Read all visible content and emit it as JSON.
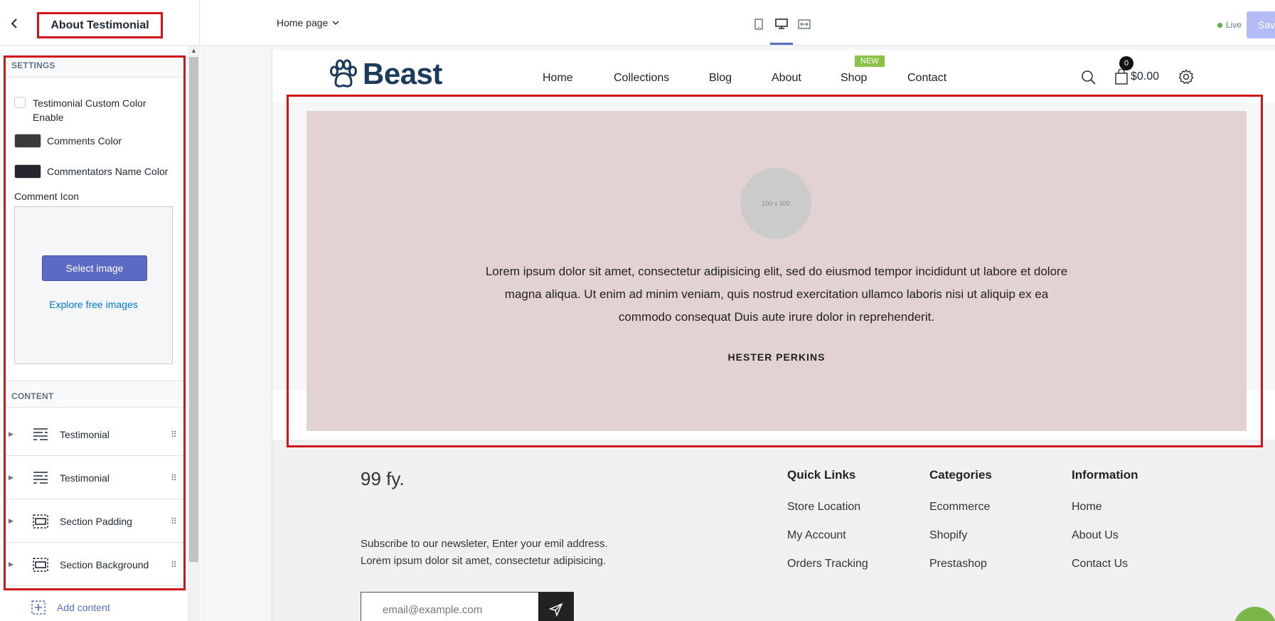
{
  "header": {
    "section_title": "About Testimonial",
    "page_selector": "Home page",
    "live_label": "Live",
    "save_label": "Save"
  },
  "sidebar": {
    "settings_heading": "SETTINGS",
    "custom_color_label": "Testimonial Custom Color Enable",
    "comments_color_label": "Comments Color",
    "comments_color": "#3a3a3a",
    "name_color_label": "Commentators Name Color",
    "name_color": "#25262b",
    "comment_icon_label": "Comment Icon",
    "select_image_label": "Select image",
    "explore_label": "Explore free images",
    "content_heading": "CONTENT",
    "blocks": [
      {
        "label": "Testimonial",
        "icon": "text-lines-icon"
      },
      {
        "label": "Testimonial",
        "icon": "text-lines-icon"
      },
      {
        "label": "Section Padding",
        "icon": "section-icon"
      },
      {
        "label": "Section Background",
        "icon": "section-icon"
      }
    ],
    "add_content_label": "Add content"
  },
  "store": {
    "logo_text": "Beast",
    "nav": [
      "Home",
      "Collections",
      "Blog",
      "About",
      "Shop",
      "Contact"
    ],
    "new_badge": "NEW",
    "cart_count": "0",
    "cart_total": "$0.00",
    "testimonial": {
      "avatar_placeholder": "100 x 100",
      "quote": "Lorem ipsum dolor sit amet, consectetur adipisicing elit, sed do eiusmod tempor incididunt ut labore et dolore magna aliqua. Ut enim ad minim veniam, quis nostrud exercitation ullamco laboris nisi ut aliquip ex ea commodo consequat Duis aute irure dolor in reprehenderit.",
      "author": "HESTER PERKINS"
    },
    "footer": {
      "brand": "99 fy.",
      "subscribe_line1": "Subscribe to our newsleter, Enter your emil address.",
      "subscribe_line2": "Lorem ipsum dolor sit amet, consectetur adipisicing.",
      "email_placeholder": "email@example.com",
      "columns": [
        {
          "heading": "Quick Links",
          "links": [
            "Store Location",
            "My Account",
            "Orders Tracking"
          ]
        },
        {
          "heading": "Categories",
          "links": [
            "Ecommerce",
            "Shopify",
            "Prestashop"
          ]
        },
        {
          "heading": "Information",
          "links": [
            "Home",
            "About Us",
            "Contact Us"
          ]
        }
      ]
    }
  },
  "colors": {
    "accent": "#5c6ac4",
    "highlight": "#d0141b",
    "testimonial_bg": "#e3d2d2",
    "badge": "#8bc34a"
  }
}
